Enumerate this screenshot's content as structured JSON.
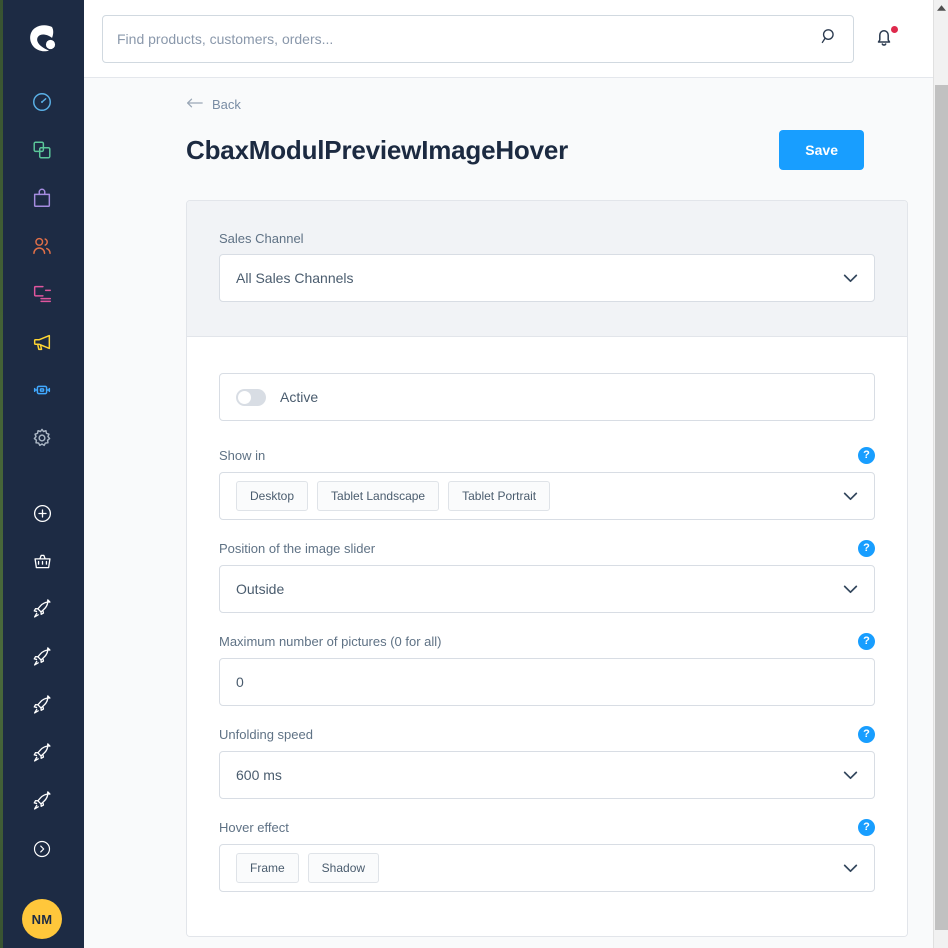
{
  "sidebar": {
    "logo": "shopware-logo",
    "items": [
      {
        "name": "dashboard",
        "icon": "gauge-icon",
        "color": "#5ab0e6"
      },
      {
        "name": "catalogues",
        "icon": "copy-squares-icon",
        "color": "#5bc79a"
      },
      {
        "name": "orders",
        "icon": "shopping-bag-icon",
        "color": "#a58ce0"
      },
      {
        "name": "customers",
        "icon": "users-icon",
        "color": "#e06f48"
      },
      {
        "name": "content",
        "icon": "content-layout-icon",
        "color": "#e0569e"
      },
      {
        "name": "marketing",
        "icon": "megaphone-icon",
        "color": "#ffd633"
      },
      {
        "name": "extensions",
        "icon": "plug-icon",
        "color": "#41a9ff"
      },
      {
        "name": "settings",
        "icon": "gear-icon",
        "color": "#aab6c4"
      }
    ],
    "apps": [
      {
        "name": "add-app",
        "icon": "plus-circle-icon",
        "color": "#ffffff"
      },
      {
        "name": "basket-app",
        "icon": "basket-icon",
        "color": "#ffffff"
      },
      {
        "name": "rocket-app-1",
        "icon": "rocket-icon",
        "color": "#ffffff"
      },
      {
        "name": "rocket-app-2",
        "icon": "rocket-icon",
        "color": "#ffffff"
      },
      {
        "name": "rocket-app-3",
        "icon": "rocket-icon",
        "color": "#ffffff"
      },
      {
        "name": "rocket-app-4",
        "icon": "rocket-icon",
        "color": "#ffffff"
      },
      {
        "name": "rocket-app-5",
        "icon": "rocket-icon",
        "color": "#ffffff"
      },
      {
        "name": "expand-menu",
        "icon": "chevron-right-circle-icon",
        "color": "#ffffff"
      }
    ],
    "avatar_initials": "NM",
    "avatar_color": "#ffc73b",
    "background_color": "#1d2b44"
  },
  "topbar": {
    "search_placeholder": "Find products, customers, orders...",
    "search_value": "",
    "search_icon": "search-icon",
    "notification_icon": "bell-icon",
    "notification_badge_color": "#de294c"
  },
  "header": {
    "back_label": "Back",
    "back_icon": "arrow-left-icon",
    "title": "CbaxModulPreviewImageHover",
    "save_label": "Save",
    "save_color": "#189eff"
  },
  "card": {
    "sales_channel": {
      "label": "Sales Channel",
      "value": "All Sales Channels",
      "chevron_icon": "chevron-down-icon"
    },
    "active_toggle": {
      "label": "Active",
      "checked": false
    },
    "fields": [
      {
        "name": "show-in",
        "label": "Show in",
        "type": "tags",
        "help_icon": "help-circle-icon",
        "tags": [
          "Desktop",
          "Tablet Landscape",
          "Tablet Portrait"
        ],
        "chevron_icon": "chevron-down-icon"
      },
      {
        "name": "position-of-the-image-slider",
        "label": "Position of the image slider",
        "type": "select",
        "help_icon": "help-circle-icon",
        "value": "Outside",
        "chevron_icon": "chevron-down-icon"
      },
      {
        "name": "maximum-number-of-pictures",
        "label": "Maximum number of pictures (0 for all)",
        "type": "input",
        "help_icon": "help-circle-icon",
        "value": "0"
      },
      {
        "name": "unfolding-speed",
        "label": "Unfolding speed",
        "type": "select",
        "help_icon": "help-circle-icon",
        "value": "600 ms",
        "chevron_icon": "chevron-down-icon"
      },
      {
        "name": "hover-effect",
        "label": "Hover effect",
        "type": "tags",
        "help_icon": "help-circle-icon",
        "tags": [
          "Frame",
          "Shadow"
        ],
        "chevron_icon": "chevron-down-icon"
      }
    ]
  },
  "help_glyph": "?",
  "scrollbar": {
    "up_arrow_icon": "triangle-up-icon"
  }
}
